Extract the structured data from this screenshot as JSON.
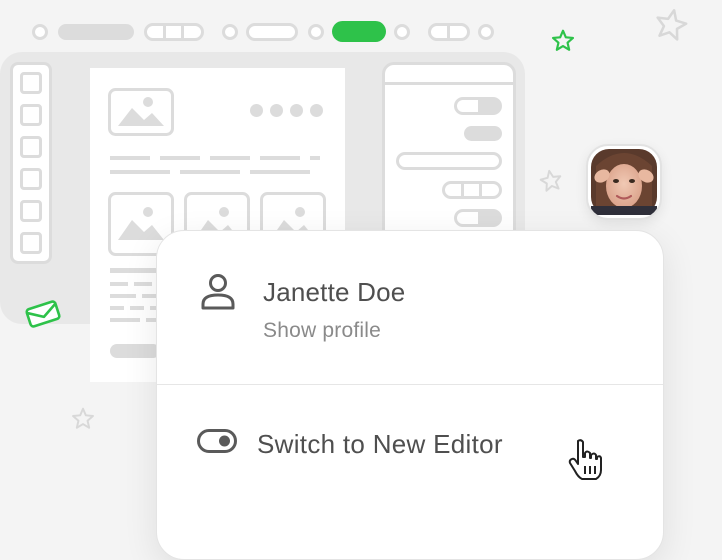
{
  "menu": {
    "user_name": "Janette Doe",
    "show_profile_label": "Show profile",
    "switch_editor_label": "Switch to New Editor"
  },
  "colors": {
    "accent": "#2ec24a",
    "wireframe": "#dcdcdc",
    "background": "#f4f4f4",
    "text": "#4f4f4f",
    "muted_text": "#8a8a8a"
  },
  "icons": [
    "user-icon",
    "toggle-icon",
    "hand-cursor-icon",
    "envelope-icon",
    "star-icon",
    "image-placeholder-icon"
  ]
}
